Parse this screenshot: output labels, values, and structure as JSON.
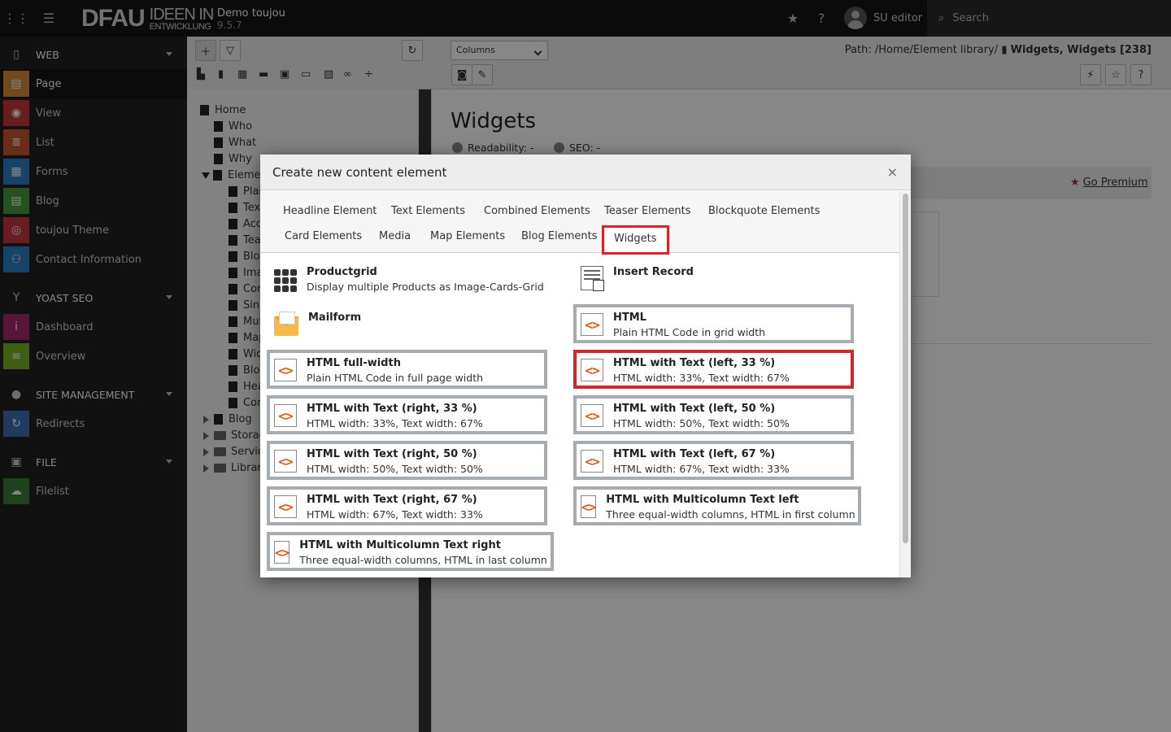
{
  "topbar": {
    "logo_main": "DFAU",
    "logo_line1": "IDEEN IN",
    "logo_line2": "ENTWICKLUNG",
    "site_name": "Demo toujou",
    "version": "9.5.7",
    "user": "SU editor",
    "search_placeholder": "Search"
  },
  "sidebar": {
    "groups": [
      {
        "label": "WEB",
        "items": [
          "Page",
          "View",
          "List",
          "Forms",
          "Blog",
          "toujou Theme",
          "Contact Information"
        ]
      },
      {
        "label": "YOAST SEO",
        "items": [
          "Dashboard",
          "Overview"
        ]
      },
      {
        "label": "SITE MANAGEMENT",
        "items": [
          "Redirects"
        ]
      },
      {
        "label": "FILE",
        "items": [
          "Filelist"
        ]
      }
    ]
  },
  "docheader": {
    "view_select": "Columns",
    "path_prefix": "Path: /Home/Element library/",
    "path_page": "Widgets, Widgets [238]"
  },
  "tree": {
    "nodes": [
      "Home",
      "Who",
      "What",
      "Why",
      "Eleme",
      "Plai",
      "Tex",
      "Acc",
      "Tea",
      "Blo",
      "Ima",
      "Cor",
      "Sin",
      "Mul",
      "Map",
      "Wid",
      "Blo",
      "Hea",
      "Cor",
      "Blog",
      "Storag",
      "Servic",
      "Librar"
    ]
  },
  "content": {
    "title": "Widgets",
    "readability": "Readability: -",
    "seo": "SEO: -",
    "premium": "Go Premium"
  },
  "modal": {
    "title": "Create new content element",
    "close": "×",
    "tabs": [
      "Headline Element",
      "Text Elements",
      "Combined Elements",
      "Teaser Elements",
      "Blockquote Elements",
      "Card Elements",
      "Media",
      "Map Elements",
      "Blog Elements",
      "Widgets"
    ],
    "active_tab": "Widgets",
    "elements": [
      {
        "title": "Productgrid",
        "desc": "Display multiple Products as Image-Cards-Grid",
        "icon": "grid-icon"
      },
      {
        "title": "Insert Record",
        "desc": "",
        "icon": "insert-record-icon"
      },
      {
        "title": "Mailform",
        "desc": "",
        "icon": "mailform-icon"
      },
      {
        "title": "HTML",
        "desc": "Plain HTML Code in grid width",
        "icon": "html-code-icon"
      },
      {
        "title": "HTML full-width",
        "desc": "Plain HTML Code in full page width",
        "icon": "html-code-icon"
      },
      {
        "title": "HTML with Text (left, 33 %)",
        "desc": "HTML width: 33%, Text width: 67%",
        "icon": "html-code-icon"
      },
      {
        "title": "HTML with Text (right, 33 %)",
        "desc": "HTML width: 33%, Text width: 67%",
        "icon": "html-code-icon"
      },
      {
        "title": "HTML with Text (left, 50 %)",
        "desc": "HTML width: 50%, Text width: 50%",
        "icon": "html-code-icon"
      },
      {
        "title": "HTML with Text (right, 50 %)",
        "desc": "HTML width: 50%, Text width: 50%",
        "icon": "html-code-icon"
      },
      {
        "title": "HTML with Text (left, 67 %)",
        "desc": "HTML width: 67%, Text width: 33%",
        "icon": "html-code-icon"
      },
      {
        "title": "HTML with Text (right, 67 %)",
        "desc": "HTML width: 67%, Text width: 33%",
        "icon": "html-code-icon"
      },
      {
        "title": "HTML with Multicolumn Text left",
        "desc": "Three equal-width columns, HTML in first column",
        "icon": "html-code-icon"
      },
      {
        "title": "HTML with Multicolumn Text right",
        "desc": "Three equal-width columns, HTML in last column",
        "icon": "html-code-icon"
      }
    ]
  },
  "colors": {
    "highlight": "#d9232a",
    "accent_orange": "#e05a1b",
    "topbar": "#151515",
    "sidebar": "#212121"
  }
}
